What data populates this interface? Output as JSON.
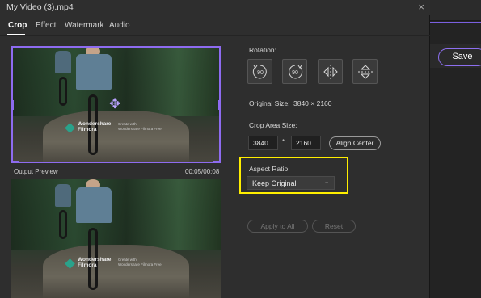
{
  "window": {
    "title": "My Video (3).mp4",
    "close_glyph": "×"
  },
  "tabs": [
    {
      "label": "Crop",
      "active": true
    },
    {
      "label": "Effect",
      "active": false
    },
    {
      "label": "Watermark",
      "active": false
    },
    {
      "label": "Audio",
      "active": false
    }
  ],
  "preview": {
    "output_label": "Output Preview",
    "timecode": "00:05/00:08",
    "watermark_brand_line1": "Wondershare",
    "watermark_brand_line2": "Filmora",
    "watermark_small_line1": "Create with",
    "watermark_small_line2": "Wondershare Filmora Free"
  },
  "crop": {
    "rotation_label": "Rotation:",
    "rotate_left_value": "90",
    "rotate_right_value": "90",
    "original_size_label": "Original Size:",
    "original_size_value": "3840 × 2160",
    "crop_area_label": "Crop Area Size:",
    "width_value": "3840",
    "times_glyph": "*",
    "height_value": "2160",
    "align_center_label": "Align Center",
    "aspect_ratio_label": "Aspect Ratio:",
    "aspect_ratio_value": "Keep Original",
    "apply_all_label": "Apply to All",
    "reset_label": "Reset"
  },
  "background_app": {
    "save_label": "Save"
  },
  "colors": {
    "accent": "#8e6bf0",
    "highlight": "#ffee00"
  }
}
